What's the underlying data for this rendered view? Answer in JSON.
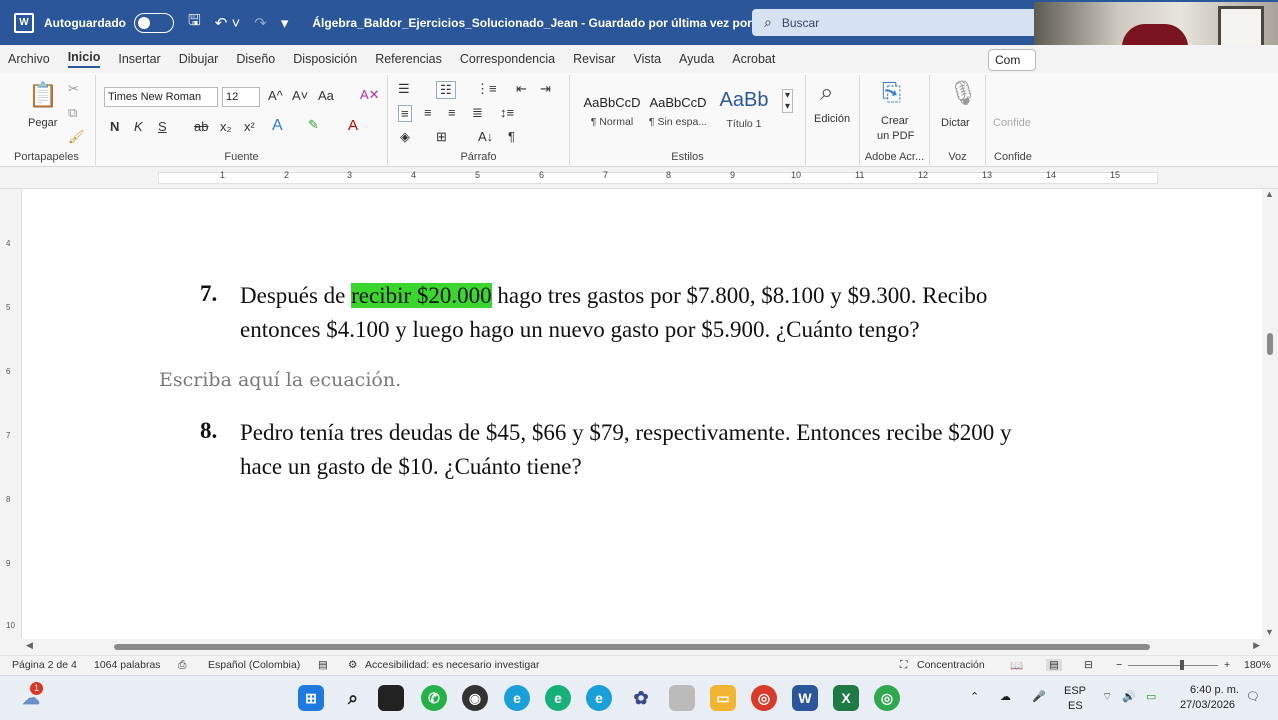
{
  "titlebar": {
    "autosave_label": "Autoguardado",
    "document_title": "Álgebra_Baldor_Ejercicios_Solucionado_Jean  -  Guardado por última vez por el u...",
    "search_placeholder": "Buscar"
  },
  "menu": {
    "items": [
      "Archivo",
      "Inicio",
      "Insertar",
      "Dibujar",
      "Diseño",
      "Disposición",
      "Referencias",
      "Correspondencia",
      "Revisar",
      "Vista",
      "Ayuda",
      "Acrobat"
    ],
    "active": "Inicio",
    "comment_label": "Com"
  },
  "ribbon": {
    "clipboard": {
      "paste_label": "Pegar",
      "group_label": "Portapapeles"
    },
    "font": {
      "family": "Times New Roman",
      "size": "12",
      "grow": "A^",
      "shrink": "A˅",
      "case": "Aa",
      "bold": "N",
      "italic": "K",
      "underline": "S",
      "strike": "ab",
      "subscript": "x₂",
      "superscript": "x²",
      "effects": "A",
      "highlight": "✎",
      "color": "A",
      "group_label": "Fuente"
    },
    "paragraph": {
      "group_label": "Párrafo",
      "pilcrow": "¶"
    },
    "styles": {
      "items": [
        {
          "preview": "AaBbCcD",
          "name": "¶ Normal"
        },
        {
          "preview": "AaBbCcD",
          "name": "¶ Sin espa..."
        },
        {
          "preview": "AaBb",
          "name": "Título 1"
        }
      ],
      "group_label": "Estilos"
    },
    "editing": {
      "label": "Edición"
    },
    "adobe": {
      "label1": "Crear",
      "label2": "un PDF",
      "group_label": "Adobe Acr..."
    },
    "voice": {
      "label": "Dictar",
      "group_label": "Voz"
    },
    "sensitivity": {
      "label": "Confide",
      "group_label": "Confide"
    }
  },
  "ruler": {
    "numbers": [
      "1",
      "2",
      "3",
      "4",
      "5",
      "6",
      "7",
      "8",
      "9",
      "10",
      "11",
      "12",
      "13",
      "14",
      "15"
    ],
    "vertical": [
      "4",
      "5",
      "6",
      "7",
      "8",
      "9",
      "10"
    ]
  },
  "document": {
    "q7_number": "7.",
    "q7_line1_before": "Después de ",
    "q7_line1_highlight": "recibir $20.000",
    "q7_line1_after": " hago tres gastos por $7.800, $8.100 y $9.300. Recibo",
    "q7_line2": "entonces $4.100 y luego hago un nuevo gasto por $5.900. ¿Cuánto tengo?",
    "equation_placeholder": "Escriba aquí la ecuación.",
    "q8_number": "8.",
    "q8_line1": "Pedro tenía tres deudas de $45, $66 y $79, respectivamente. Entonces recibe $200 y",
    "q8_line2": "hace un gasto de $10. ¿Cuánto tiene?"
  },
  "statusbar": {
    "page": "Página 2 de 4",
    "words": "1064 palabras",
    "language": "Español (Colombia)",
    "accessibility": "Accesibilidad: es necesario investigar",
    "focus": "Concentración",
    "zoom": "180%"
  },
  "taskbar": {
    "weather_badge": "1",
    "lang_line1": "ESP",
    "lang_line2": "ES",
    "time": "6:40 p. m.",
    "date": "27/03/2026"
  },
  "colors": {
    "titlebar": "#2b579a",
    "highlight": "#3ad62f",
    "page": "#ffffff"
  }
}
